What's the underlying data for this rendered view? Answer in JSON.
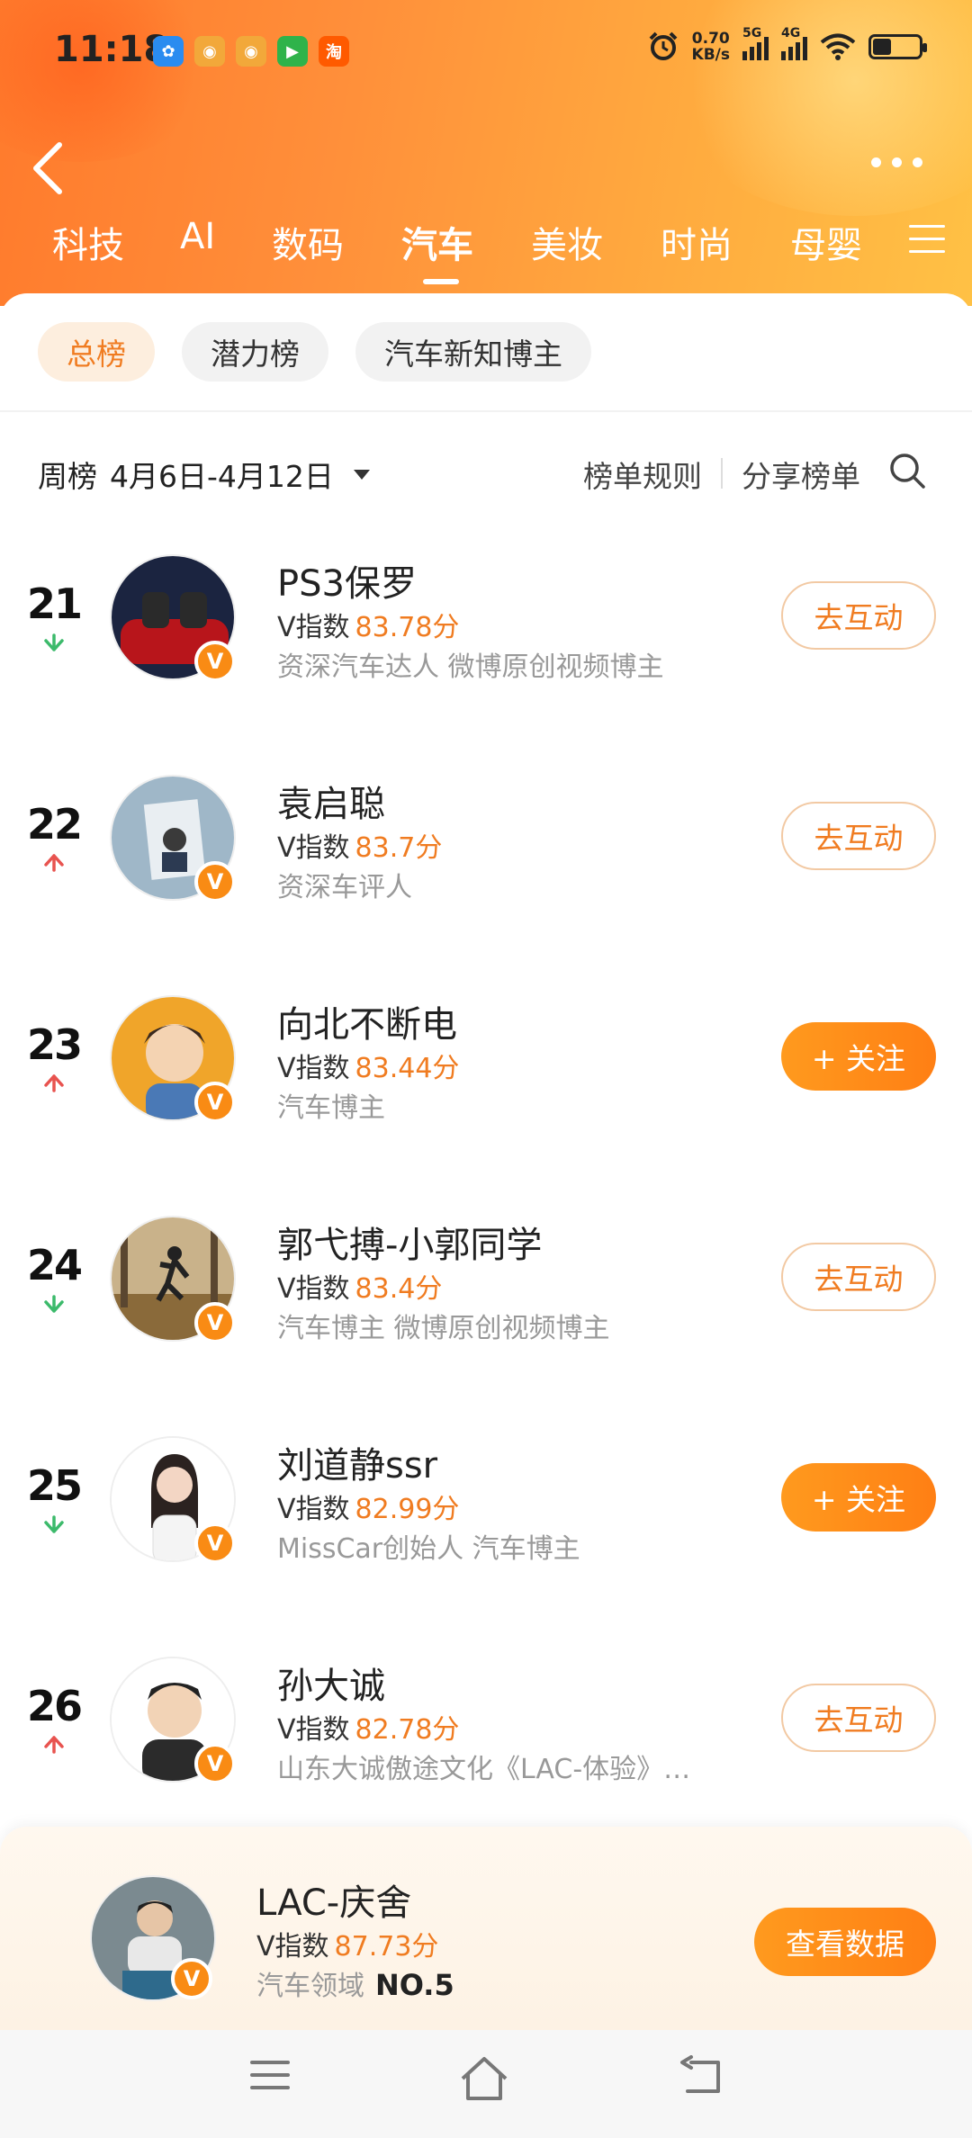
{
  "status_bar": {
    "time": "11:18",
    "net_speed_value": "0.70",
    "net_speed_unit": "KB/s",
    "sim1": "5G",
    "sim2": "4G",
    "app_icons": [
      {
        "name": "baidu-icon",
        "color": "#2a8cf0",
        "glyph": "✿"
      },
      {
        "name": "weibo-icon",
        "color": "#f2a83a",
        "glyph": "◉"
      },
      {
        "name": "weibo-icon-2",
        "color": "#f2a83a",
        "glyph": "◉"
      },
      {
        "name": "video-icon",
        "color": "#2fb34a",
        "glyph": "▶"
      },
      {
        "name": "taobao-icon",
        "color": "#ff5a00",
        "glyph": "淘"
      }
    ]
  },
  "tabs": [
    "科技",
    "AI",
    "数码",
    "汽车",
    "美妆",
    "时尚",
    "母婴"
  ],
  "active_tab": "汽车",
  "chips": [
    "总榜",
    "潜力榜",
    "汽车新知博主"
  ],
  "filter": {
    "period_type": "周榜",
    "period_range": "4月6日-4月12日",
    "rules": "榜单规则",
    "share": "分享榜单"
  },
  "score_label": "V指数",
  "list": [
    {
      "rank": "21",
      "trend": "down",
      "name": "PS3保罗",
      "score": "83.78分",
      "desc": "资深汽车达人 微博原创视频博主",
      "action": "去互动",
      "action_style": "outline"
    },
    {
      "rank": "22",
      "trend": "up",
      "name": "袁启聪",
      "score": "83.7分",
      "desc": "资深车评人",
      "action": "去互动",
      "action_style": "outline"
    },
    {
      "rank": "23",
      "trend": "up",
      "name": "向北不断电",
      "score": "83.44分",
      "desc": "汽车博主",
      "action": "+ 关注",
      "action_style": "fill"
    },
    {
      "rank": "24",
      "trend": "down",
      "name": "郭弋搏-小郭同学",
      "score": "83.4分",
      "desc": "汽车博主 微博原创视频博主",
      "action": "去互动",
      "action_style": "outline"
    },
    {
      "rank": "25",
      "trend": "down",
      "name": "刘道静ssr",
      "score": "82.99分",
      "desc": "MissCar创始人 汽车博主",
      "action": "+ 关注",
      "action_style": "fill"
    },
    {
      "rank": "26",
      "trend": "up",
      "name": "孙大诚",
      "score": "82.78分",
      "desc": "山东大诚傲途文化《LAC-体验》…",
      "action": "去互动",
      "action_style": "outline"
    }
  ],
  "my": {
    "name": "LAC-庆舍",
    "score": "87.73分",
    "domain": "汽车领域",
    "rank": "NO.5",
    "action": "查看数据"
  },
  "colors": {
    "accent": "#f07c21",
    "up": "#e8534f",
    "down": "#3cba6b"
  }
}
